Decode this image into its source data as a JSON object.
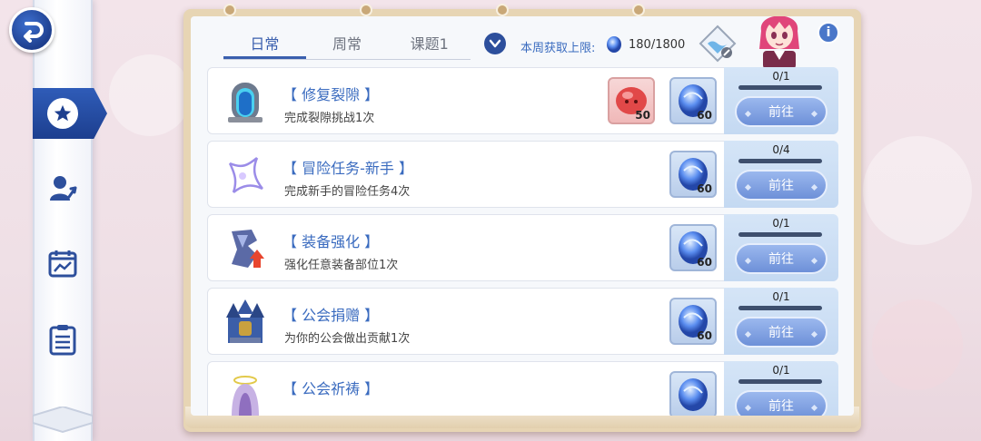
{
  "sidebar": {
    "items": [
      {
        "name": "back",
        "icon": "back-icon"
      },
      {
        "name": "missions",
        "icon": "star-icon",
        "active": true
      },
      {
        "name": "character",
        "icon": "character-up-icon"
      },
      {
        "name": "calendar-stats",
        "icon": "calendar-chart-icon"
      },
      {
        "name": "notes",
        "icon": "clipboard-icon"
      }
    ]
  },
  "header": {
    "tabs": [
      {
        "label": "日常",
        "active": true
      },
      {
        "label": "周常",
        "active": false
      },
      {
        "label": "课题1",
        "active": false
      }
    ],
    "weekly_limit_label": "本周获取上限:",
    "weekly_limit_value": "180/1800",
    "info_label": "i"
  },
  "tasks": [
    {
      "title": "【 修复裂隙 】",
      "desc": "完成裂隙挑战1次",
      "icon": "portal-icon",
      "rewards": [
        {
          "type": "red-mochi-icon",
          "qty": "50"
        },
        {
          "type": "blue-crystal-icon",
          "qty": "60"
        }
      ],
      "progress": "0/1",
      "progress_fraction": 0,
      "button": "前往"
    },
    {
      "title": "【 冒险任务-新手 】",
      "desc": "完成新手的冒险任务4次",
      "icon": "sparkle-star-icon",
      "rewards": [
        {
          "type": "blue-crystal-icon",
          "qty": "60"
        }
      ],
      "progress": "0/4",
      "progress_fraction": 0,
      "button": "前往"
    },
    {
      "title": "【 装备强化 】",
      "desc": "强化任意装备部位1次",
      "icon": "gear-upgrade-icon",
      "rewards": [
        {
          "type": "blue-crystal-icon",
          "qty": "60"
        }
      ],
      "progress": "0/1",
      "progress_fraction": 0,
      "button": "前往"
    },
    {
      "title": "【 公会捐赠 】",
      "desc": "为你的公会做出贡献1次",
      "icon": "guild-castle-icon",
      "rewards": [
        {
          "type": "blue-crystal-icon",
          "qty": "60"
        }
      ],
      "progress": "0/1",
      "progress_fraction": 0,
      "button": "前往"
    },
    {
      "title": "【 公会祈祷 】",
      "desc": "",
      "icon": "hooded-priest-icon",
      "rewards": [
        {
          "type": "blue-crystal-icon",
          "qty": ""
        }
      ],
      "progress": "0/1",
      "progress_fraction": 0,
      "button": "前往"
    }
  ],
  "colors": {
    "accent": "#3a5fae",
    "title_blue": "#3a6bbf",
    "panel_frame": "#e7d5b4",
    "progress_track": "#3e4f6e"
  }
}
